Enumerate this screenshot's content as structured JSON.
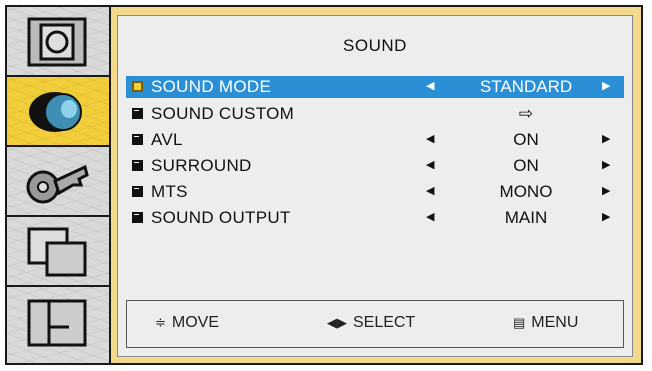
{
  "menu": {
    "title": "SOUND",
    "rows": [
      {
        "label": "SOUND MODE",
        "value": "STANDARD",
        "selected": true
      },
      {
        "label": "SOUND CUSTOM",
        "value": "⇨",
        "selected": false
      },
      {
        "label": "AVL",
        "value": "ON",
        "selected": false
      },
      {
        "label": "SURROUND",
        "value": "ON",
        "selected": false
      },
      {
        "label": "MTS",
        "value": "MONO",
        "selected": false
      },
      {
        "label": "SOUND OUTPUT",
        "value": "MAIN",
        "selected": false
      }
    ],
    "arrows": {
      "left": "◀",
      "right": "▶"
    }
  },
  "footer": {
    "move_icon": "≑",
    "move_label": "MOVE",
    "select_icon": "◀▶",
    "select_label": "SELECT",
    "menu_icon": "▤",
    "menu_label": "MENU"
  },
  "sidebar": {
    "items": [
      "picture-icon",
      "sound-icon",
      "setup-icon",
      "pip-icon",
      "function-icon"
    ],
    "active": "sound-icon"
  },
  "colors": {
    "frame": "#f3d98c",
    "panel": "#ededed",
    "selected_row": "#2b8fd6",
    "active_sidebar": "#f2cf3a"
  }
}
